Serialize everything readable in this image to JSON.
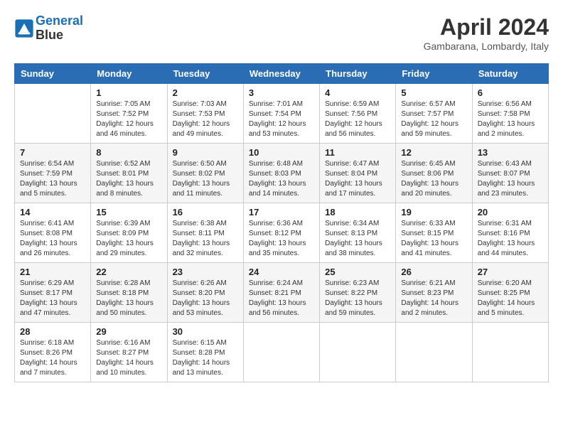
{
  "header": {
    "logo_line1": "General",
    "logo_line2": "Blue",
    "title": "April 2024",
    "location": "Gambarana, Lombardy, Italy"
  },
  "days_of_week": [
    "Sunday",
    "Monday",
    "Tuesday",
    "Wednesday",
    "Thursday",
    "Friday",
    "Saturday"
  ],
  "weeks": [
    [
      {
        "num": "",
        "info": ""
      },
      {
        "num": "1",
        "info": "Sunrise: 7:05 AM\nSunset: 7:52 PM\nDaylight: 12 hours\nand 46 minutes."
      },
      {
        "num": "2",
        "info": "Sunrise: 7:03 AM\nSunset: 7:53 PM\nDaylight: 12 hours\nand 49 minutes."
      },
      {
        "num": "3",
        "info": "Sunrise: 7:01 AM\nSunset: 7:54 PM\nDaylight: 12 hours\nand 53 minutes."
      },
      {
        "num": "4",
        "info": "Sunrise: 6:59 AM\nSunset: 7:56 PM\nDaylight: 12 hours\nand 56 minutes."
      },
      {
        "num": "5",
        "info": "Sunrise: 6:57 AM\nSunset: 7:57 PM\nDaylight: 12 hours\nand 59 minutes."
      },
      {
        "num": "6",
        "info": "Sunrise: 6:56 AM\nSunset: 7:58 PM\nDaylight: 13 hours\nand 2 minutes."
      }
    ],
    [
      {
        "num": "7",
        "info": "Sunrise: 6:54 AM\nSunset: 7:59 PM\nDaylight: 13 hours\nand 5 minutes."
      },
      {
        "num": "8",
        "info": "Sunrise: 6:52 AM\nSunset: 8:01 PM\nDaylight: 13 hours\nand 8 minutes."
      },
      {
        "num": "9",
        "info": "Sunrise: 6:50 AM\nSunset: 8:02 PM\nDaylight: 13 hours\nand 11 minutes."
      },
      {
        "num": "10",
        "info": "Sunrise: 6:48 AM\nSunset: 8:03 PM\nDaylight: 13 hours\nand 14 minutes."
      },
      {
        "num": "11",
        "info": "Sunrise: 6:47 AM\nSunset: 8:04 PM\nDaylight: 13 hours\nand 17 minutes."
      },
      {
        "num": "12",
        "info": "Sunrise: 6:45 AM\nSunset: 8:06 PM\nDaylight: 13 hours\nand 20 minutes."
      },
      {
        "num": "13",
        "info": "Sunrise: 6:43 AM\nSunset: 8:07 PM\nDaylight: 13 hours\nand 23 minutes."
      }
    ],
    [
      {
        "num": "14",
        "info": "Sunrise: 6:41 AM\nSunset: 8:08 PM\nDaylight: 13 hours\nand 26 minutes."
      },
      {
        "num": "15",
        "info": "Sunrise: 6:39 AM\nSunset: 8:09 PM\nDaylight: 13 hours\nand 29 minutes."
      },
      {
        "num": "16",
        "info": "Sunrise: 6:38 AM\nSunset: 8:11 PM\nDaylight: 13 hours\nand 32 minutes."
      },
      {
        "num": "17",
        "info": "Sunrise: 6:36 AM\nSunset: 8:12 PM\nDaylight: 13 hours\nand 35 minutes."
      },
      {
        "num": "18",
        "info": "Sunrise: 6:34 AM\nSunset: 8:13 PM\nDaylight: 13 hours\nand 38 minutes."
      },
      {
        "num": "19",
        "info": "Sunrise: 6:33 AM\nSunset: 8:15 PM\nDaylight: 13 hours\nand 41 minutes."
      },
      {
        "num": "20",
        "info": "Sunrise: 6:31 AM\nSunset: 8:16 PM\nDaylight: 13 hours\nand 44 minutes."
      }
    ],
    [
      {
        "num": "21",
        "info": "Sunrise: 6:29 AM\nSunset: 8:17 PM\nDaylight: 13 hours\nand 47 minutes."
      },
      {
        "num": "22",
        "info": "Sunrise: 6:28 AM\nSunset: 8:18 PM\nDaylight: 13 hours\nand 50 minutes."
      },
      {
        "num": "23",
        "info": "Sunrise: 6:26 AM\nSunset: 8:20 PM\nDaylight: 13 hours\nand 53 minutes."
      },
      {
        "num": "24",
        "info": "Sunrise: 6:24 AM\nSunset: 8:21 PM\nDaylight: 13 hours\nand 56 minutes."
      },
      {
        "num": "25",
        "info": "Sunrise: 6:23 AM\nSunset: 8:22 PM\nDaylight: 13 hours\nand 59 minutes."
      },
      {
        "num": "26",
        "info": "Sunrise: 6:21 AM\nSunset: 8:23 PM\nDaylight: 14 hours\nand 2 minutes."
      },
      {
        "num": "27",
        "info": "Sunrise: 6:20 AM\nSunset: 8:25 PM\nDaylight: 14 hours\nand 5 minutes."
      }
    ],
    [
      {
        "num": "28",
        "info": "Sunrise: 6:18 AM\nSunset: 8:26 PM\nDaylight: 14 hours\nand 7 minutes."
      },
      {
        "num": "29",
        "info": "Sunrise: 6:16 AM\nSunset: 8:27 PM\nDaylight: 14 hours\nand 10 minutes."
      },
      {
        "num": "30",
        "info": "Sunrise: 6:15 AM\nSunset: 8:28 PM\nDaylight: 14 hours\nand 13 minutes."
      },
      {
        "num": "",
        "info": ""
      },
      {
        "num": "",
        "info": ""
      },
      {
        "num": "",
        "info": ""
      },
      {
        "num": "",
        "info": ""
      }
    ]
  ]
}
